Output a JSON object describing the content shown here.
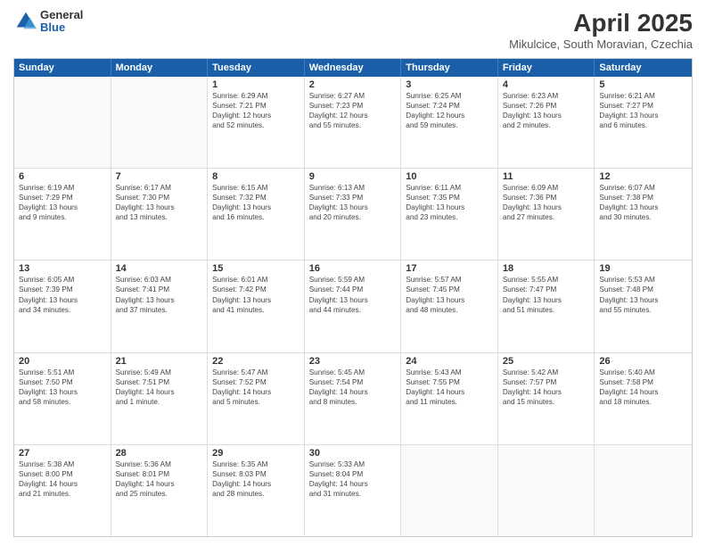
{
  "header": {
    "logo_general": "General",
    "logo_blue": "Blue",
    "month_title": "April 2025",
    "location": "Mikulcice, South Moravian, Czechia"
  },
  "weekdays": [
    "Sunday",
    "Monday",
    "Tuesday",
    "Wednesday",
    "Thursday",
    "Friday",
    "Saturday"
  ],
  "rows": [
    [
      {
        "day": "",
        "lines": []
      },
      {
        "day": "",
        "lines": []
      },
      {
        "day": "1",
        "lines": [
          "Sunrise: 6:29 AM",
          "Sunset: 7:21 PM",
          "Daylight: 12 hours",
          "and 52 minutes."
        ]
      },
      {
        "day": "2",
        "lines": [
          "Sunrise: 6:27 AM",
          "Sunset: 7:23 PM",
          "Daylight: 12 hours",
          "and 55 minutes."
        ]
      },
      {
        "day": "3",
        "lines": [
          "Sunrise: 6:25 AM",
          "Sunset: 7:24 PM",
          "Daylight: 12 hours",
          "and 59 minutes."
        ]
      },
      {
        "day": "4",
        "lines": [
          "Sunrise: 6:23 AM",
          "Sunset: 7:26 PM",
          "Daylight: 13 hours",
          "and 2 minutes."
        ]
      },
      {
        "day": "5",
        "lines": [
          "Sunrise: 6:21 AM",
          "Sunset: 7:27 PM",
          "Daylight: 13 hours",
          "and 6 minutes."
        ]
      }
    ],
    [
      {
        "day": "6",
        "lines": [
          "Sunrise: 6:19 AM",
          "Sunset: 7:29 PM",
          "Daylight: 13 hours",
          "and 9 minutes."
        ]
      },
      {
        "day": "7",
        "lines": [
          "Sunrise: 6:17 AM",
          "Sunset: 7:30 PM",
          "Daylight: 13 hours",
          "and 13 minutes."
        ]
      },
      {
        "day": "8",
        "lines": [
          "Sunrise: 6:15 AM",
          "Sunset: 7:32 PM",
          "Daylight: 13 hours",
          "and 16 minutes."
        ]
      },
      {
        "day": "9",
        "lines": [
          "Sunrise: 6:13 AM",
          "Sunset: 7:33 PM",
          "Daylight: 13 hours",
          "and 20 minutes."
        ]
      },
      {
        "day": "10",
        "lines": [
          "Sunrise: 6:11 AM",
          "Sunset: 7:35 PM",
          "Daylight: 13 hours",
          "and 23 minutes."
        ]
      },
      {
        "day": "11",
        "lines": [
          "Sunrise: 6:09 AM",
          "Sunset: 7:36 PM",
          "Daylight: 13 hours",
          "and 27 minutes."
        ]
      },
      {
        "day": "12",
        "lines": [
          "Sunrise: 6:07 AM",
          "Sunset: 7:38 PM",
          "Daylight: 13 hours",
          "and 30 minutes."
        ]
      }
    ],
    [
      {
        "day": "13",
        "lines": [
          "Sunrise: 6:05 AM",
          "Sunset: 7:39 PM",
          "Daylight: 13 hours",
          "and 34 minutes."
        ]
      },
      {
        "day": "14",
        "lines": [
          "Sunrise: 6:03 AM",
          "Sunset: 7:41 PM",
          "Daylight: 13 hours",
          "and 37 minutes."
        ]
      },
      {
        "day": "15",
        "lines": [
          "Sunrise: 6:01 AM",
          "Sunset: 7:42 PM",
          "Daylight: 13 hours",
          "and 41 minutes."
        ]
      },
      {
        "day": "16",
        "lines": [
          "Sunrise: 5:59 AM",
          "Sunset: 7:44 PM",
          "Daylight: 13 hours",
          "and 44 minutes."
        ]
      },
      {
        "day": "17",
        "lines": [
          "Sunrise: 5:57 AM",
          "Sunset: 7:45 PM",
          "Daylight: 13 hours",
          "and 48 minutes."
        ]
      },
      {
        "day": "18",
        "lines": [
          "Sunrise: 5:55 AM",
          "Sunset: 7:47 PM",
          "Daylight: 13 hours",
          "and 51 minutes."
        ]
      },
      {
        "day": "19",
        "lines": [
          "Sunrise: 5:53 AM",
          "Sunset: 7:48 PM",
          "Daylight: 13 hours",
          "and 55 minutes."
        ]
      }
    ],
    [
      {
        "day": "20",
        "lines": [
          "Sunrise: 5:51 AM",
          "Sunset: 7:50 PM",
          "Daylight: 13 hours",
          "and 58 minutes."
        ]
      },
      {
        "day": "21",
        "lines": [
          "Sunrise: 5:49 AM",
          "Sunset: 7:51 PM",
          "Daylight: 14 hours",
          "and 1 minute."
        ]
      },
      {
        "day": "22",
        "lines": [
          "Sunrise: 5:47 AM",
          "Sunset: 7:52 PM",
          "Daylight: 14 hours",
          "and 5 minutes."
        ]
      },
      {
        "day": "23",
        "lines": [
          "Sunrise: 5:45 AM",
          "Sunset: 7:54 PM",
          "Daylight: 14 hours",
          "and 8 minutes."
        ]
      },
      {
        "day": "24",
        "lines": [
          "Sunrise: 5:43 AM",
          "Sunset: 7:55 PM",
          "Daylight: 14 hours",
          "and 11 minutes."
        ]
      },
      {
        "day": "25",
        "lines": [
          "Sunrise: 5:42 AM",
          "Sunset: 7:57 PM",
          "Daylight: 14 hours",
          "and 15 minutes."
        ]
      },
      {
        "day": "26",
        "lines": [
          "Sunrise: 5:40 AM",
          "Sunset: 7:58 PM",
          "Daylight: 14 hours",
          "and 18 minutes."
        ]
      }
    ],
    [
      {
        "day": "27",
        "lines": [
          "Sunrise: 5:38 AM",
          "Sunset: 8:00 PM",
          "Daylight: 14 hours",
          "and 21 minutes."
        ]
      },
      {
        "day": "28",
        "lines": [
          "Sunrise: 5:36 AM",
          "Sunset: 8:01 PM",
          "Daylight: 14 hours",
          "and 25 minutes."
        ]
      },
      {
        "day": "29",
        "lines": [
          "Sunrise: 5:35 AM",
          "Sunset: 8:03 PM",
          "Daylight: 14 hours",
          "and 28 minutes."
        ]
      },
      {
        "day": "30",
        "lines": [
          "Sunrise: 5:33 AM",
          "Sunset: 8:04 PM",
          "Daylight: 14 hours",
          "and 31 minutes."
        ]
      },
      {
        "day": "",
        "lines": []
      },
      {
        "day": "",
        "lines": []
      },
      {
        "day": "",
        "lines": []
      }
    ]
  ]
}
